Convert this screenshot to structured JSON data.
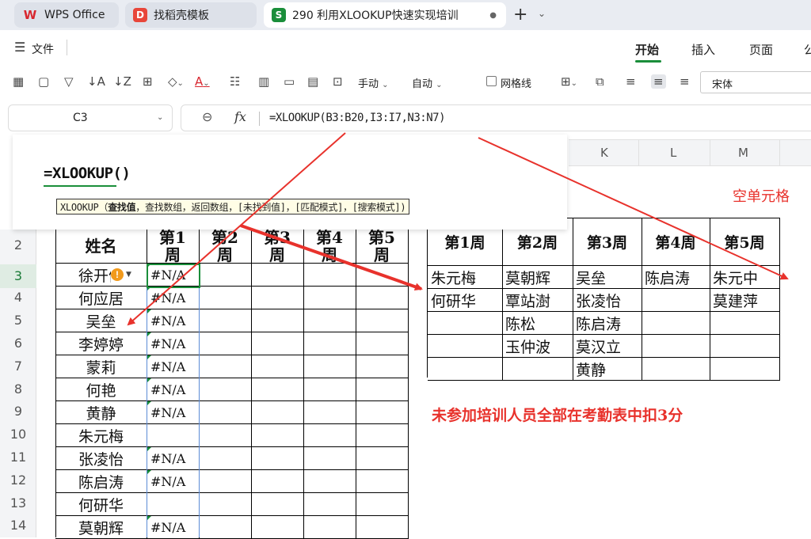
{
  "tabs": [
    {
      "label": "WPS Office",
      "icon": "wps-logo-icon"
    },
    {
      "label": "找稻壳模板",
      "icon": "docer-icon"
    },
    {
      "label": "290 利用XLOOKUP快速实现培训",
      "icon": "spreadsheet-icon",
      "icon_text": "S",
      "active": true
    }
  ],
  "tab_plus": "+",
  "menu": {
    "file": "文件",
    "ribbon_tabs": [
      "开始",
      "插入",
      "页面",
      "公"
    ]
  },
  "toolbar": {
    "manual": "手动",
    "auto": "自动",
    "gridlines": "网格线",
    "font": "宋体"
  },
  "formula_bar": {
    "cell_ref": "C3",
    "fx": "fx",
    "formula": "=XLOOKUP(B3:B20,I3:I7,N3:N7)"
  },
  "columns": [
    "K",
    "L",
    "M"
  ],
  "autocomplete": {
    "formula": "=XLOOKUP()",
    "tip_prefix": "XLOOKUP（",
    "tip_bold": "查找值",
    "tip_rest": "，查找数组，返回数组，[未找到值]，[匹配模式]，[搜索模式])"
  },
  "rows": [
    "2",
    "3",
    "4",
    "5",
    "6",
    "7",
    "8",
    "9",
    "10",
    "11",
    "12",
    "13",
    "14"
  ],
  "left_table": {
    "headers": [
      "姓名",
      "第1周",
      "第2周",
      "第3周",
      "第4周",
      "第5周"
    ],
    "names": [
      "徐开健",
      "何应居",
      "吴垒",
      "李婷婷",
      "蒙莉",
      "何艳",
      "黄静",
      "朱元梅",
      "张凌怡",
      "陈启涛",
      "何研华",
      "莫朝辉"
    ],
    "week1": [
      "#N/A",
      "#N/A",
      "#N/A",
      "#N/A",
      "#N/A",
      "#N/A",
      "#N/A",
      "",
      "#N/A",
      "#N/A",
      "",
      "#N/A"
    ]
  },
  "right_table": {
    "headers": [
      "第1周",
      "第2周",
      "第3周",
      "第4周",
      "第5周"
    ],
    "rows": [
      [
        "朱元梅",
        "莫朝辉",
        "吴垒",
        "陈启涛",
        "朱元中"
      ],
      [
        "何研华",
        "覃站澍",
        "张凌怡",
        "",
        "莫建萍"
      ],
      [
        "",
        "陈松",
        "陈启涛",
        "",
        ""
      ],
      [
        "",
        "玉仲波",
        "莫汉立",
        "",
        ""
      ],
      [
        "",
        "",
        "黄静",
        "",
        ""
      ]
    ]
  },
  "annotations": {
    "empty_cell": "空单元格",
    "note": "未参加培训人员全部在考勤表中扣3分"
  },
  "colors": {
    "accent_green": "#1a8e3a",
    "annotation_red": "#e8322c",
    "warning_orange": "#f29a1c"
  }
}
